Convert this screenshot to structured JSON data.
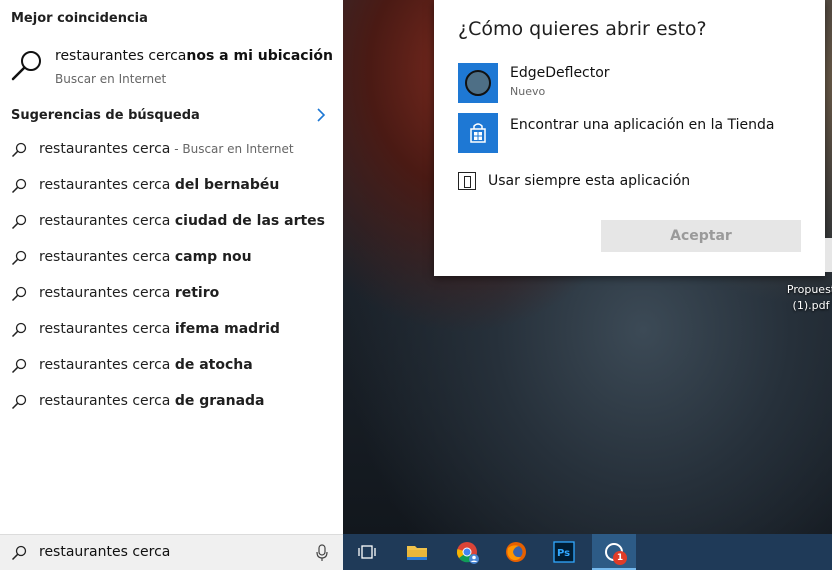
{
  "search_panel": {
    "best_match_title": "Mejor coincidencia",
    "best_match": {
      "query_prefix": "restaurantes cerca",
      "query_completion": "nos a mi ubicación",
      "subtitle": "Buscar en Internet"
    },
    "suggestions_title": "Sugerencias de búsqueda",
    "suggestions": [
      {
        "prefix": "restaurantes cerca",
        "completion": "",
        "hint": " - Buscar en Internet"
      },
      {
        "prefix": "restaurantes cerca ",
        "completion": "del bernabéu",
        "hint": ""
      },
      {
        "prefix": "restaurantes cerca ",
        "completion": "ciudad de las artes",
        "hint": ""
      },
      {
        "prefix": "restaurantes cerca ",
        "completion": "camp nou",
        "hint": ""
      },
      {
        "prefix": "restaurantes cerca ",
        "completion": "retiro",
        "hint": ""
      },
      {
        "prefix": "restaurantes cerca ",
        "completion": "ifema madrid",
        "hint": ""
      },
      {
        "prefix": "restaurantes cerca ",
        "completion": "de atocha",
        "hint": ""
      },
      {
        "prefix": "restaurantes cerca ",
        "completion": "de granada",
        "hint": ""
      }
    ]
  },
  "search_box": {
    "value": "restaurantes cerca"
  },
  "dialog": {
    "heading": "¿Cómo quieres abrir esto?",
    "apps": [
      {
        "name": "EdgeDeflector",
        "note": "Nuevo"
      },
      {
        "name": "Encontrar una aplicación en la Tienda",
        "note": ""
      }
    ],
    "always_use_label": "Usar siempre esta aplicación",
    "accept_label": "Aceptar"
  },
  "desktop": {
    "file_label_line1": "Propuest",
    "file_label_line2": "(1).pdf"
  },
  "taskbar": {
    "items": [
      "task-view-icon",
      "file-explorer-icon",
      "chrome-icon",
      "firefox-icon",
      "photoshop-icon",
      "cortana-icon"
    ],
    "notification_count": "1"
  },
  "colors": {
    "accent_blue": "#1e78d4",
    "taskbar": "#1f3a58",
    "badge_red": "#e03c28"
  }
}
